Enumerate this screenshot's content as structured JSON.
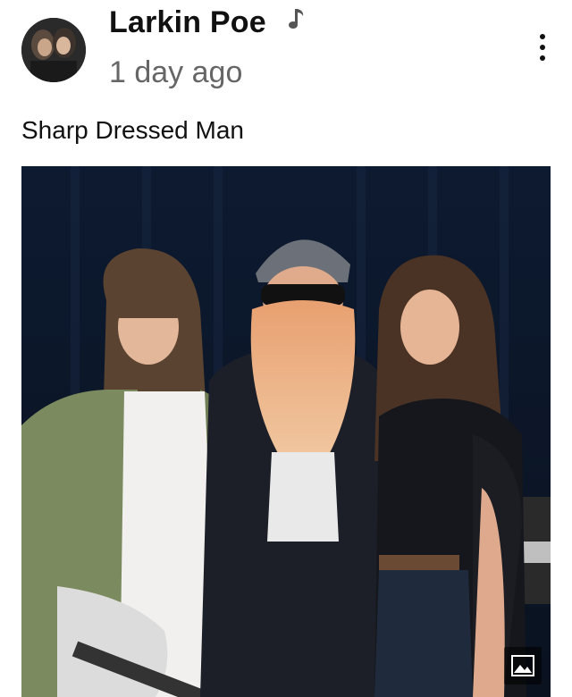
{
  "post": {
    "author": "Larkin Poe",
    "author_badge_icon": "music-note-icon",
    "timestamp": "1 day ago",
    "caption": "Sharp Dressed Man",
    "menu_icon": "more-vert-icon",
    "photo_badge_icon": "image-icon"
  }
}
